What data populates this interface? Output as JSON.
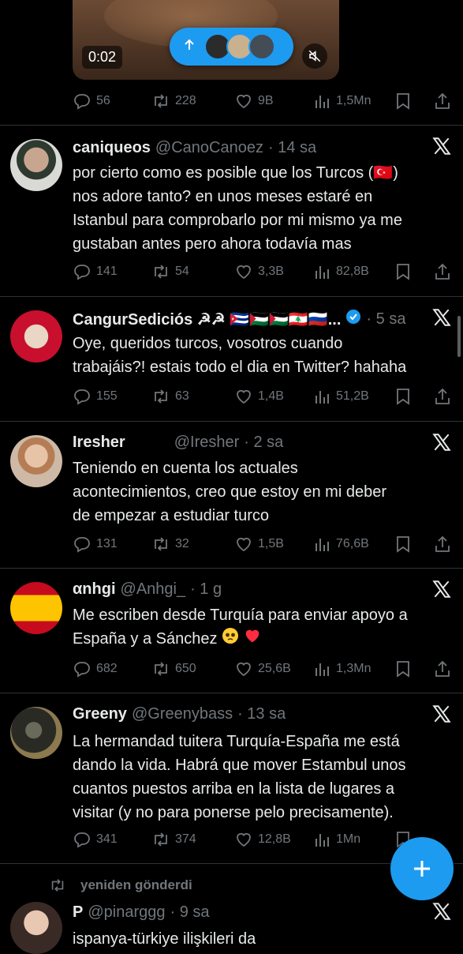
{
  "top_video": {
    "duration": "0:02"
  },
  "top_actions": {
    "replies": "56",
    "retweets": "228",
    "likes": "9B",
    "views": "1,5Mn"
  },
  "tweets": [
    {
      "name": "caniqueos",
      "handle": "@CanoCanoez",
      "time": "· 14 sa",
      "text_lines": [
        "por cierto como es posible que los Turcos (🇹🇷)",
        "nos adore tanto? en unos meses estaré en",
        "Istanbul para comprobarlo por mi mismo ya me",
        "gustaban antes pero ahora todavía mas"
      ],
      "replies": "141",
      "retweets": "54",
      "likes": "3,3B",
      "views": "82,8B"
    },
    {
      "name": "CangurSediciós ☭☭ 🇨🇺🇵🇸🇵🇸🇱🇧🇷🇺...",
      "handle": "",
      "time": "· 5 sa",
      "text_lines": [
        "Oye, queridos turcos, vosotros cuando",
        "trabajáis?! estais todo el dia en Twitter? hahaha"
      ],
      "replies": "155",
      "retweets": "63",
      "likes": "1,4B",
      "views": "51,2B"
    },
    {
      "name": "Iresher",
      "handle": "@Iresher",
      "time": "· 2 sa",
      "text_lines": [
        "Teniendo en cuenta los actuales",
        "acontecimientos, creo que estoy en mi deber",
        "de empezar a estudiar turco"
      ],
      "replies": "131",
      "retweets": "32",
      "likes": "1,5B",
      "views": "76,6B"
    },
    {
      "name": "αnhgi",
      "handle": "@Anhgi_",
      "time": "· 1 g",
      "text_lines": [
        "Me escriben desde Turquía para enviar apoyo a",
        "España y a Sánchez"
      ],
      "replies": "682",
      "retweets": "650",
      "likes": "25,6B",
      "views": "1,3Mn"
    },
    {
      "name": "Greeny",
      "handle": "@Greenybass",
      "time": "· 13 sa",
      "text_lines": [
        "La hermandad tuitera Turquía-España me está",
        "dando la vida. Habrá que mover Estambul unos",
        "cuantos puestos arriba en la lista de lugares a",
        "visitar (y no para ponerse pelo precisamente)."
      ],
      "replies": "341",
      "retweets": "374",
      "likes": "12,8B",
      "views": "1Mn"
    }
  ],
  "retweet_banner": {
    "label": "yeniden gönderdi"
  },
  "last_tweet": {
    "name": "P",
    "handle": "@pinarggg",
    "time": "· 9 sa",
    "partial_text": "ispanya-türkiye ilişkileri da"
  },
  "colors": {
    "accent": "#1d9bf0",
    "muted": "#71767b",
    "background": "#000000",
    "divider": "#2f3336"
  }
}
